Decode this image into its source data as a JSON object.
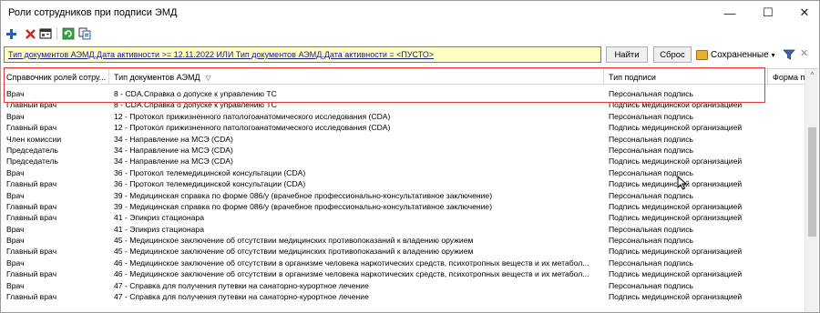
{
  "window": {
    "title": "Роли сотрудников при подписи ЭМД",
    "controls": {
      "minimize": "—",
      "maximize": "☐",
      "close": "✕"
    }
  },
  "toolbar": {
    "buttons": [
      "add-icon",
      "delete-icon",
      "properties-icon",
      "refresh-icon",
      "copy-icon"
    ]
  },
  "filter": {
    "text": "Тип документов АЭМД.Дата активности >= 12.11.2022 ИЛИ Тип документов АЭМД.Дата активности = <ПУСТО>",
    "find_label": "Найти",
    "reset_label": "Сброс",
    "saved_label": "Сохраненные",
    "saved_caret": "▾",
    "clear_symbol": "✕"
  },
  "grid": {
    "columns": [
      "Справочник ролей сотру...",
      "Тип документов АЭМД",
      "Тип подписи",
      "Форма под"
    ],
    "sort_symbol": "▽",
    "scroll_up_symbol": "^",
    "rows": [
      [
        "Врач",
        "8 - CDA.Справка о допуске к управлению ТС",
        "Персональная подпись"
      ],
      [
        "Главный врач",
        "8 - CDA.Справка о допуске к управлению ТС",
        "Подпись медицинской организацией"
      ],
      [
        "Врач",
        "12 - Протокол прижизненного патологоанатомического исследования (CDA)",
        "Персональная подпись"
      ],
      [
        "Главный врач",
        "12 - Протокол прижизненного патологоанатомического исследования (CDA)",
        "Подпись медицинской организацией"
      ],
      [
        "Член комиссии",
        "34 - Направление на МСЭ (CDA)",
        "Персональная подпись"
      ],
      [
        "Председатель",
        "34 - Направление на МСЭ (CDA)",
        "Персональная подпись"
      ],
      [
        "Председатель",
        "34 - Направление на МСЭ (CDA)",
        "Подпись медицинской организацией"
      ],
      [
        "Врач",
        "36 - Протокол телемедицинской консультации (CDA)",
        "Персональная подпись"
      ],
      [
        "Главный врач",
        "36 - Протокол телемедицинской консультации (CDA)",
        "Подпись медицинской организацией"
      ],
      [
        "Врач",
        "39 - Медицинская справка по форме 086/у (врачебное профессионально-консультативное заключение)",
        "Персональная подпись"
      ],
      [
        "Главный врач",
        "39 - Медицинская справка по форме 086/у (врачебное профессионально-консультативное заключение)",
        "Подпись медицинской организацией"
      ],
      [
        "Главный врач",
        "41 - Эпикриз стационара",
        "Подпись медицинской организацией"
      ],
      [
        "Врач",
        "41 - Эпикриз стационара",
        "Персональная подпись"
      ],
      [
        "Врач",
        "45 - Медицинское заключение об отсутствии медицинских противопоказаний к владению оружием",
        "Персональная подпись"
      ],
      [
        "Главный врач",
        "45 - Медицинское заключение об отсутствии медицинских противопоказаний к владению оружием",
        "Подпись медицинской организацией"
      ],
      [
        "Врач",
        "46 - Медицинское заключение об отсутствии в организме человека наркотических средств, психотропных веществ и их метабол...",
        "Персональная подпись"
      ],
      [
        "Главный врач",
        "46 - Медицинское заключение об отсутствии в организме человека наркотических средств, психотропных веществ и их метабол...",
        "Подпись медицинской организацией"
      ],
      [
        "Врач",
        "47 - Справка для получения путевки на санаторно-курортное лечение",
        "Персональная подпись"
      ],
      [
        "Главный врач",
        "47 - Справка для получения путевки на санаторно-курортное лечение",
        "Подпись медицинской организацией"
      ]
    ]
  },
  "colors": {
    "filter_background": "#ffffc4",
    "highlight_border": "#e53a3a",
    "add_icon": "#1f5fbf",
    "delete_icon": "#d42020"
  }
}
